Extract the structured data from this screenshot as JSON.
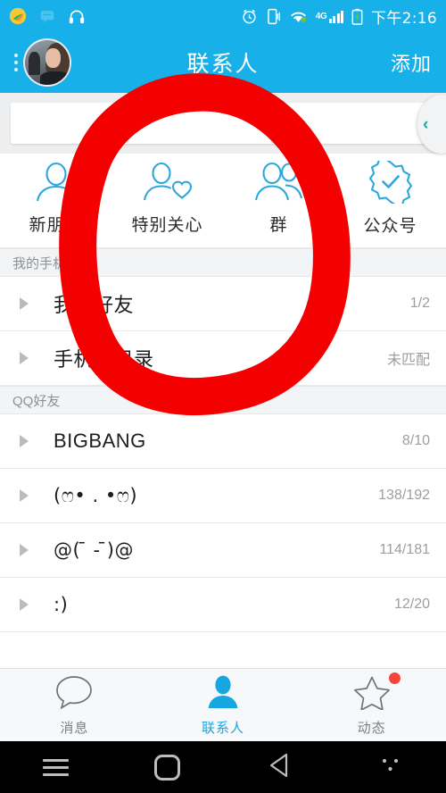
{
  "status_bar": {
    "time": "下午2:16",
    "network_label": "4G",
    "left_icons": [
      "app-leaf-icon",
      "message-muted-icon",
      "headphones-icon"
    ],
    "right_icons": [
      "alarm-clock-icon",
      "vibrate-phone-icon",
      "wifi-icon",
      "signal-bars-icon",
      "battery-icon"
    ]
  },
  "header": {
    "title": "联系人",
    "action_label": "添加",
    "avatar_name": "user-avatar",
    "menu_icon": "three-dots-icon",
    "bg_color": "#17b0e8"
  },
  "search": {
    "value": "",
    "placeholder": "",
    "drawer_chevron": "‹"
  },
  "categories": [
    {
      "label": "新朋友",
      "icon": "person-outline-icon"
    },
    {
      "label": "特别关心",
      "icon": "person-heart-icon"
    },
    {
      "label": "群",
      "icon": "group-people-icon"
    },
    {
      "label": "公众号",
      "icon": "verified-badge-icon"
    }
  ],
  "sections": [
    {
      "title": "我的手机",
      "rows": [
        {
          "name": "我的好友",
          "count": "1/2"
        },
        {
          "name": "手机通讯录",
          "count": "未匹配"
        }
      ]
    },
    {
      "title": "QQ好友",
      "rows": [
        {
          "name": "BIGBANG",
          "count": "8/10"
        },
        {
          "name": "(ෆ• . •ෆ)",
          "count": "138/192"
        },
        {
          "name": "@( ̄ - ̄)@",
          "count": "114/181"
        },
        {
          "name": ":)",
          "count": "12/20"
        }
      ]
    }
  ],
  "tabbar": [
    {
      "label": "消息",
      "icon": "speech-bubble-icon",
      "active": false,
      "badge": false
    },
    {
      "label": "联系人",
      "icon": "person-filled-icon",
      "active": true,
      "badge": false
    },
    {
      "label": "动态",
      "icon": "star-outline-icon",
      "active": false,
      "badge": true
    }
  ],
  "android_nav": [
    {
      "icon": "menu-icon"
    },
    {
      "icon": "home-icon"
    },
    {
      "icon": "back-icon"
    },
    {
      "icon": "dots-icon"
    }
  ],
  "annotation": {
    "shape": "hand-drawn-red-circle",
    "color": "#f40000"
  },
  "colors": {
    "accent": "#17b0e8",
    "annotation_red": "#f40000",
    "badge_red": "#f7443a",
    "icon_blue": "#2aa8dd"
  }
}
